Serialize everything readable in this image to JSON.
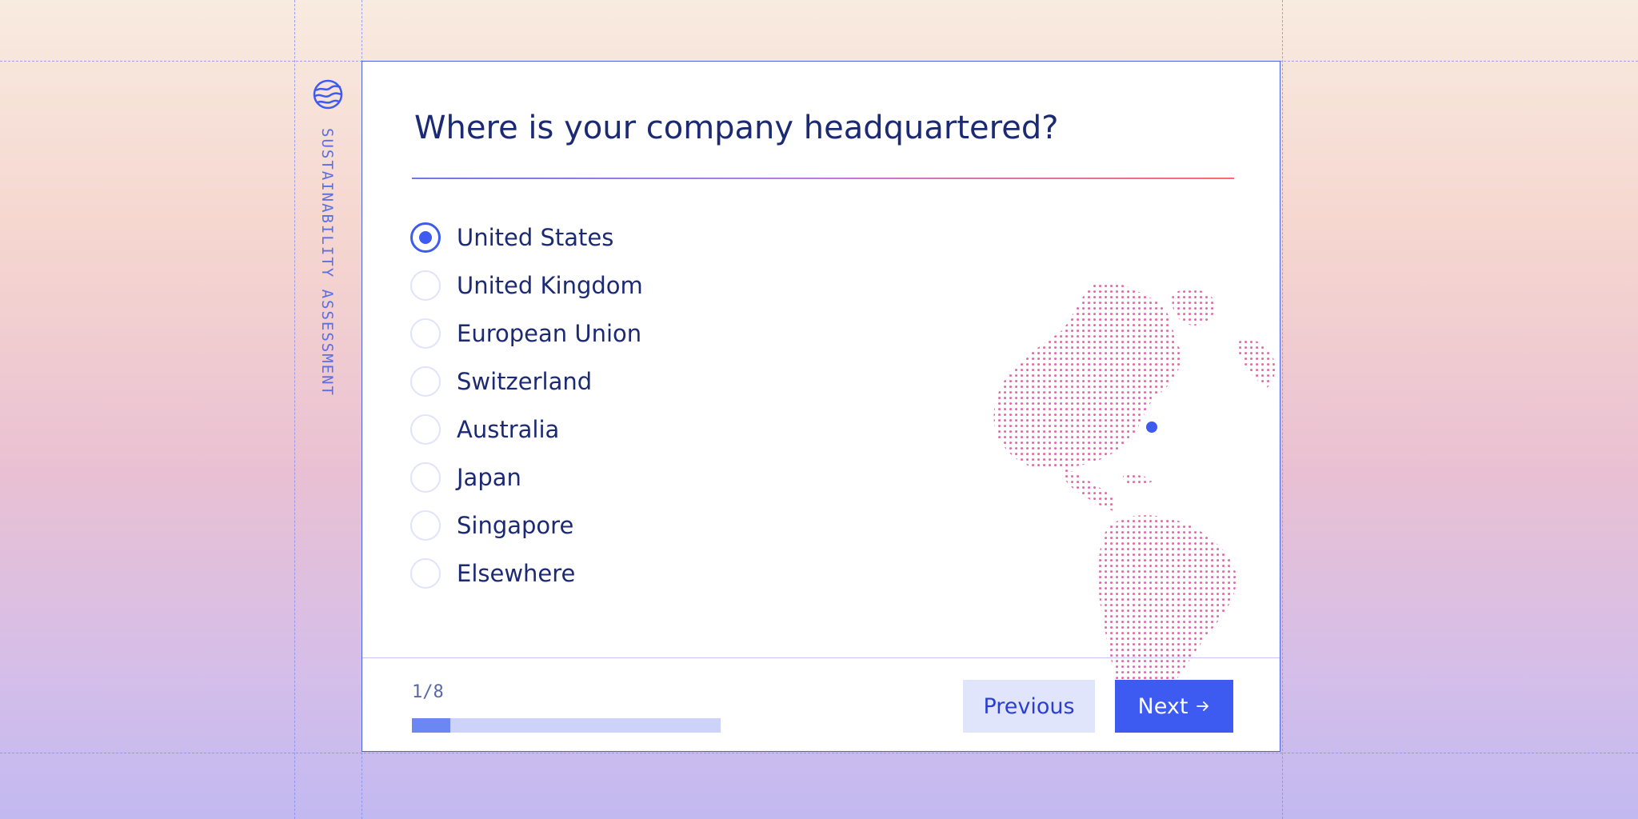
{
  "sidebar": {
    "label": "SUSTAINABILITY ASSESSMENT",
    "icon": "globe-icon"
  },
  "question": {
    "title": "Where is your company headquartered?"
  },
  "options": [
    {
      "label": "United States",
      "selected": true
    },
    {
      "label": "United Kingdom",
      "selected": false
    },
    {
      "label": "European Union",
      "selected": false
    },
    {
      "label": "Switzerland",
      "selected": false
    },
    {
      "label": "Australia",
      "selected": false
    },
    {
      "label": "Japan",
      "selected": false
    },
    {
      "label": "Singapore",
      "selected": false
    },
    {
      "label": "Elsewhere",
      "selected": false
    }
  ],
  "footer": {
    "step_text": "1/8",
    "progress_fraction": 0.125,
    "previous_label": "Previous",
    "next_label": "Next"
  },
  "colors": {
    "accent": "#3d5af1",
    "text": "#1c2a74",
    "map_dots": "#e86aa8",
    "map_marker": "#3d5af1"
  }
}
